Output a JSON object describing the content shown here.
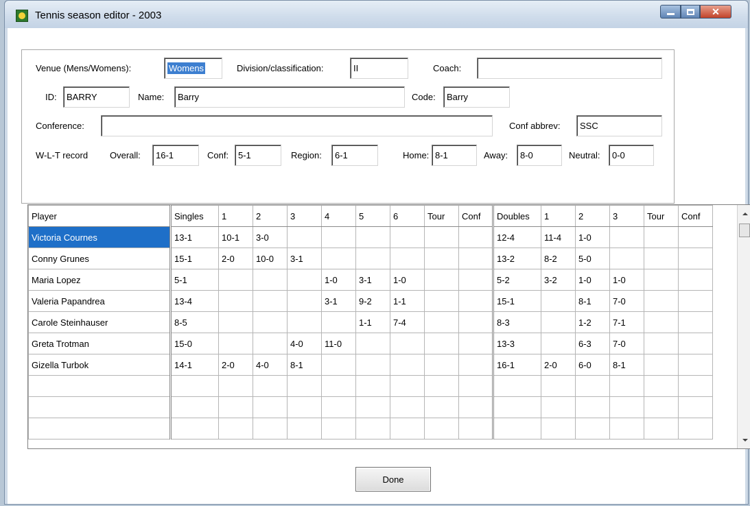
{
  "window": {
    "title": "Tennis season editor - 2003"
  },
  "form": {
    "venue_label": "Venue (Mens/Womens):",
    "venue_value": "Womens",
    "division_label": "Division/classification:",
    "division_value": "II",
    "coach_label": "Coach:",
    "coach_value": "",
    "id_label": "ID:",
    "id_value": "BARRY",
    "name_label": "Name:",
    "name_value": "Barry",
    "code_label": "Code:",
    "code_value": "Barry",
    "conference_label": "Conference:",
    "conference_value": "",
    "conf_abbrev_label": "Conf abbrev:",
    "conf_abbrev_value": "SSC",
    "wlt_label": "W-L-T record",
    "overall_label": "Overall:",
    "overall_value": "16-1",
    "conf_label": "Conf:",
    "conf_value": "5-1",
    "region_label": "Region:",
    "region_value": "6-1",
    "home_label": "Home:",
    "home_value": "8-1",
    "away_label": "Away:",
    "away_value": "8-0",
    "neutral_label": "Neutral:",
    "neutral_value": "0-0"
  },
  "grid": {
    "columns": [
      "Player",
      "Singles",
      "1",
      "2",
      "3",
      "4",
      "5",
      "6",
      "Tour",
      "Conf",
      "Doubles",
      "1",
      "2",
      "3",
      "Tour",
      "Conf"
    ],
    "rows": [
      [
        "Victoria Cournes",
        "13-1",
        "10-1",
        "3-0",
        "",
        "",
        "",
        "",
        "",
        "",
        "12-4",
        "11-4",
        "1-0",
        "",
        "",
        ""
      ],
      [
        "Conny Grunes",
        "15-1",
        "2-0",
        "10-0",
        "3-1",
        "",
        "",
        "",
        "",
        "",
        "13-2",
        "8-2",
        "5-0",
        "",
        "",
        ""
      ],
      [
        "Maria Lopez",
        "5-1",
        "",
        "",
        "",
        "1-0",
        "3-1",
        "1-0",
        "",
        "",
        "5-2",
        "3-2",
        "1-0",
        "1-0",
        "",
        ""
      ],
      [
        "Valeria Papandrea",
        "13-4",
        "",
        "",
        "",
        "3-1",
        "9-2",
        "1-1",
        "",
        "",
        "15-1",
        "",
        "8-1",
        "7-0",
        "",
        ""
      ],
      [
        "Carole Steinhauser",
        "8-5",
        "",
        "",
        "",
        "",
        "1-1",
        "7-4",
        "",
        "",
        "8-3",
        "",
        "1-2",
        "7-1",
        "",
        ""
      ],
      [
        "Greta Trotman",
        "15-0",
        "",
        "",
        "4-0",
        "11-0",
        "",
        "",
        "",
        "",
        "13-3",
        "",
        "6-3",
        "7-0",
        "",
        ""
      ],
      [
        "Gizella Turbok",
        "14-1",
        "2-0",
        "4-0",
        "8-1",
        "",
        "",
        "",
        "",
        "",
        "16-1",
        "2-0",
        "6-0",
        "8-1",
        "",
        ""
      ],
      [
        "",
        "",
        "",
        "",
        "",
        "",
        "",
        "",
        "",
        "",
        "",
        "",
        "",
        "",
        "",
        ""
      ],
      [
        "",
        "",
        "",
        "",
        "",
        "",
        "",
        "",
        "",
        "",
        "",
        "",
        "",
        "",
        "",
        ""
      ],
      [
        "",
        "",
        "",
        "",
        "",
        "",
        "",
        "",
        "",
        "",
        "",
        "",
        "",
        "",
        "",
        ""
      ]
    ],
    "selected_row": 0
  },
  "buttons": {
    "done_label": "Done"
  },
  "colors": {
    "selection": "#1e6fc8",
    "close_button": "#c1432a",
    "title_bar": "#cfdceb"
  }
}
